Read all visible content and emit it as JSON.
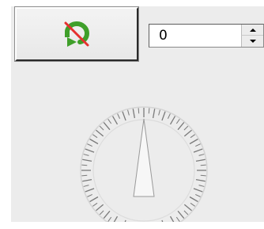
{
  "rotation_control": {
    "reset_button": {
      "icon": "reset-rotation-icon",
      "label": ""
    },
    "angle_spinner": {
      "value": "0"
    },
    "dial": {
      "angle_degrees": 0,
      "tick_count": 72,
      "major_every": 2
    }
  },
  "colors": {
    "icon_green": "#3f9f2a",
    "icon_red": "#e53030",
    "dial_ticks": "#7a7a7a",
    "dial_ring": "#d4d4d4",
    "pointer": "#9a9a9a"
  }
}
